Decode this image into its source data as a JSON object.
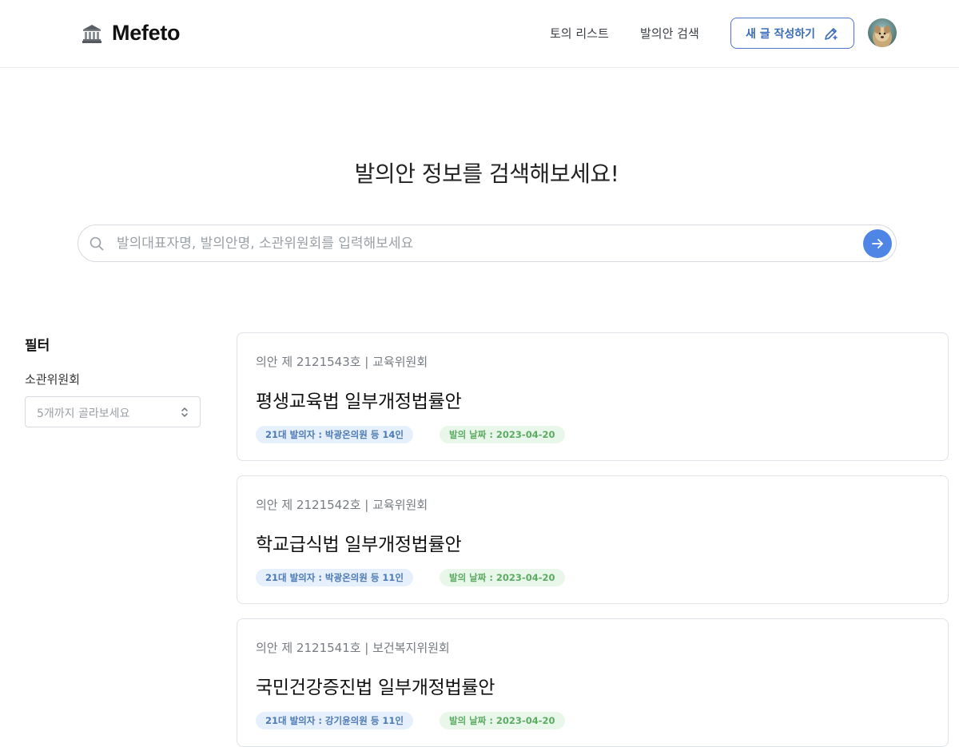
{
  "header": {
    "logo_text": "Mefeto",
    "nav": {
      "discussions": "토의 리스트",
      "bill_search": "발의안 검색"
    },
    "write_button": "새 글 작성하기"
  },
  "hero": {
    "title": "발의안 정보를 검색해보세요!",
    "search_placeholder": "발의대표자명, 발의안명, 소관위원회를 입력해보세요"
  },
  "filter": {
    "title": "필터",
    "committee_label": "소관위원회",
    "committee_placeholder": "5개까지 골라보세요"
  },
  "bills": [
    {
      "meta": "의안 제 2121543호 | 교육위원회",
      "title": "평생교육법 일부개정법률안",
      "proposer": "21대 발의자 : 박광온의원 등 14인",
      "date": "발의 날짜 : 2023-04-20"
    },
    {
      "meta": "의안 제 2121542호 | 교육위원회",
      "title": "학교급식법 일부개정법률안",
      "proposer": "21대 발의자 : 박광온의원 등 11인",
      "date": "발의 날짜 : 2023-04-20"
    },
    {
      "meta": "의안 제 2121541호 | 보건복지위원회",
      "title": "국민건강증진법 일부개정법률안",
      "proposer": "21대 발의자 : 강기윤의원 등 11인",
      "date": "발의 날짜 : 2023-04-20"
    }
  ],
  "colors": {
    "accent": "#4f86e6",
    "button_border": "#4a78c2",
    "proposer_badge_bg": "#e6f0fc",
    "date_badge_bg": "#e9f7ea"
  },
  "icons": {
    "logo": "classical-building-icon",
    "write": "pencil-edit-icon",
    "search": "magnifier-icon",
    "submit": "arrow-right-icon",
    "select": "chevron-up-down-icon"
  }
}
